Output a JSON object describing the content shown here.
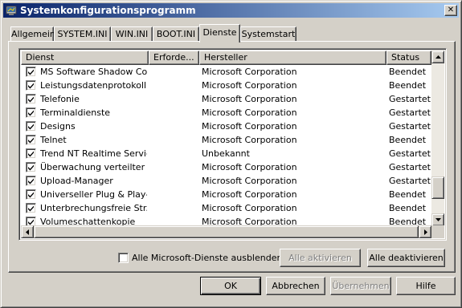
{
  "window": {
    "title": "Systemkonfigurationsprogramm",
    "title_icon": "msconfig-app-icon",
    "close_label": "✕"
  },
  "tabs": [
    {
      "label": "Allgemein",
      "active": false
    },
    {
      "label": "SYSTEM.INI",
      "active": false
    },
    {
      "label": "WIN.INI",
      "active": false
    },
    {
      "label": "BOOT.INI",
      "active": false
    },
    {
      "label": "Dienste",
      "active": true
    },
    {
      "label": "Systemstart",
      "active": false
    }
  ],
  "services_table": {
    "columns": [
      "Dienst",
      "Erforde...",
      "Hersteller",
      "Status"
    ],
    "rows": [
      {
        "checked": true,
        "name": "MS Software Shadow Co...",
        "required": "",
        "vendor": "Microsoft Corporation",
        "status": "Beendet"
      },
      {
        "checked": true,
        "name": "Leistungsdatenprotokoll...",
        "required": "",
        "vendor": "Microsoft Corporation",
        "status": "Beendet"
      },
      {
        "checked": true,
        "name": "Telefonie",
        "required": "",
        "vendor": "Microsoft Corporation",
        "status": "Gestartet"
      },
      {
        "checked": true,
        "name": "Terminaldienste",
        "required": "",
        "vendor": "Microsoft Corporation",
        "status": "Gestartet"
      },
      {
        "checked": true,
        "name": "Designs",
        "required": "",
        "vendor": "Microsoft Corporation",
        "status": "Gestartet"
      },
      {
        "checked": true,
        "name": "Telnet",
        "required": "",
        "vendor": "Microsoft Corporation",
        "status": "Beendet"
      },
      {
        "checked": true,
        "name": "Trend NT Realtime Service",
        "required": "",
        "vendor": "Unbekannt",
        "status": "Gestartet"
      },
      {
        "checked": true,
        "name": "Überwachung verteilter ...",
        "required": "",
        "vendor": "Microsoft Corporation",
        "status": "Gestartet"
      },
      {
        "checked": true,
        "name": "Upload-Manager",
        "required": "",
        "vendor": "Microsoft Corporation",
        "status": "Gestartet"
      },
      {
        "checked": true,
        "name": "Universeller Plug & Play-...",
        "required": "",
        "vendor": "Microsoft Corporation",
        "status": "Beendet"
      },
      {
        "checked": true,
        "name": "Unterbrechungsfreie Str...",
        "required": "",
        "vendor": "Microsoft Corporation",
        "status": "Beendet"
      },
      {
        "checked": true,
        "name": "Volumeschattenkopie",
        "required": "",
        "vendor": "Microsoft Corporation",
        "status": "Beendet"
      }
    ]
  },
  "hide_ms_services": {
    "label": "Alle Microsoft-Dienste ausblenden",
    "checked": false
  },
  "buttons": {
    "enable_all": {
      "label": "Alle aktivieren",
      "disabled": true
    },
    "disable_all": {
      "label": "Alle deaktivieren",
      "disabled": false
    },
    "ok": {
      "label": "OK",
      "disabled": false
    },
    "cancel": {
      "label": "Abbrechen",
      "disabled": false
    },
    "apply": {
      "label": "Übernehmen",
      "disabled": true
    },
    "help": {
      "label": "Hilfe",
      "disabled": false
    }
  },
  "colors": {
    "title_gradient_start": "#0a246a",
    "title_gradient_end": "#a6caf0",
    "face": "#d4d0c8"
  }
}
